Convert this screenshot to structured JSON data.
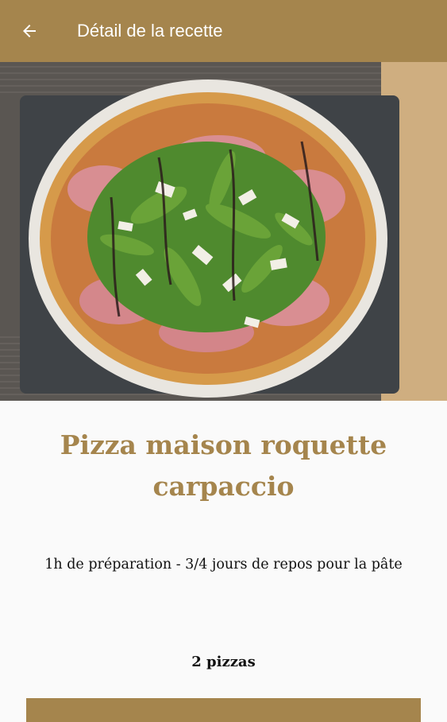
{
  "appbar": {
    "title": "Détail de la recette",
    "back_icon": "arrow-left-icon",
    "color": "#a5854d"
  },
  "hero": {
    "description_icon": "recipe-photo"
  },
  "recipe": {
    "title": "Pizza maison roquette carpaccio",
    "preparation": "1h de préparation - 3/4 jours de repos pour la pâte",
    "servings": "2 pizzas",
    "title_color": "#a5854d"
  }
}
